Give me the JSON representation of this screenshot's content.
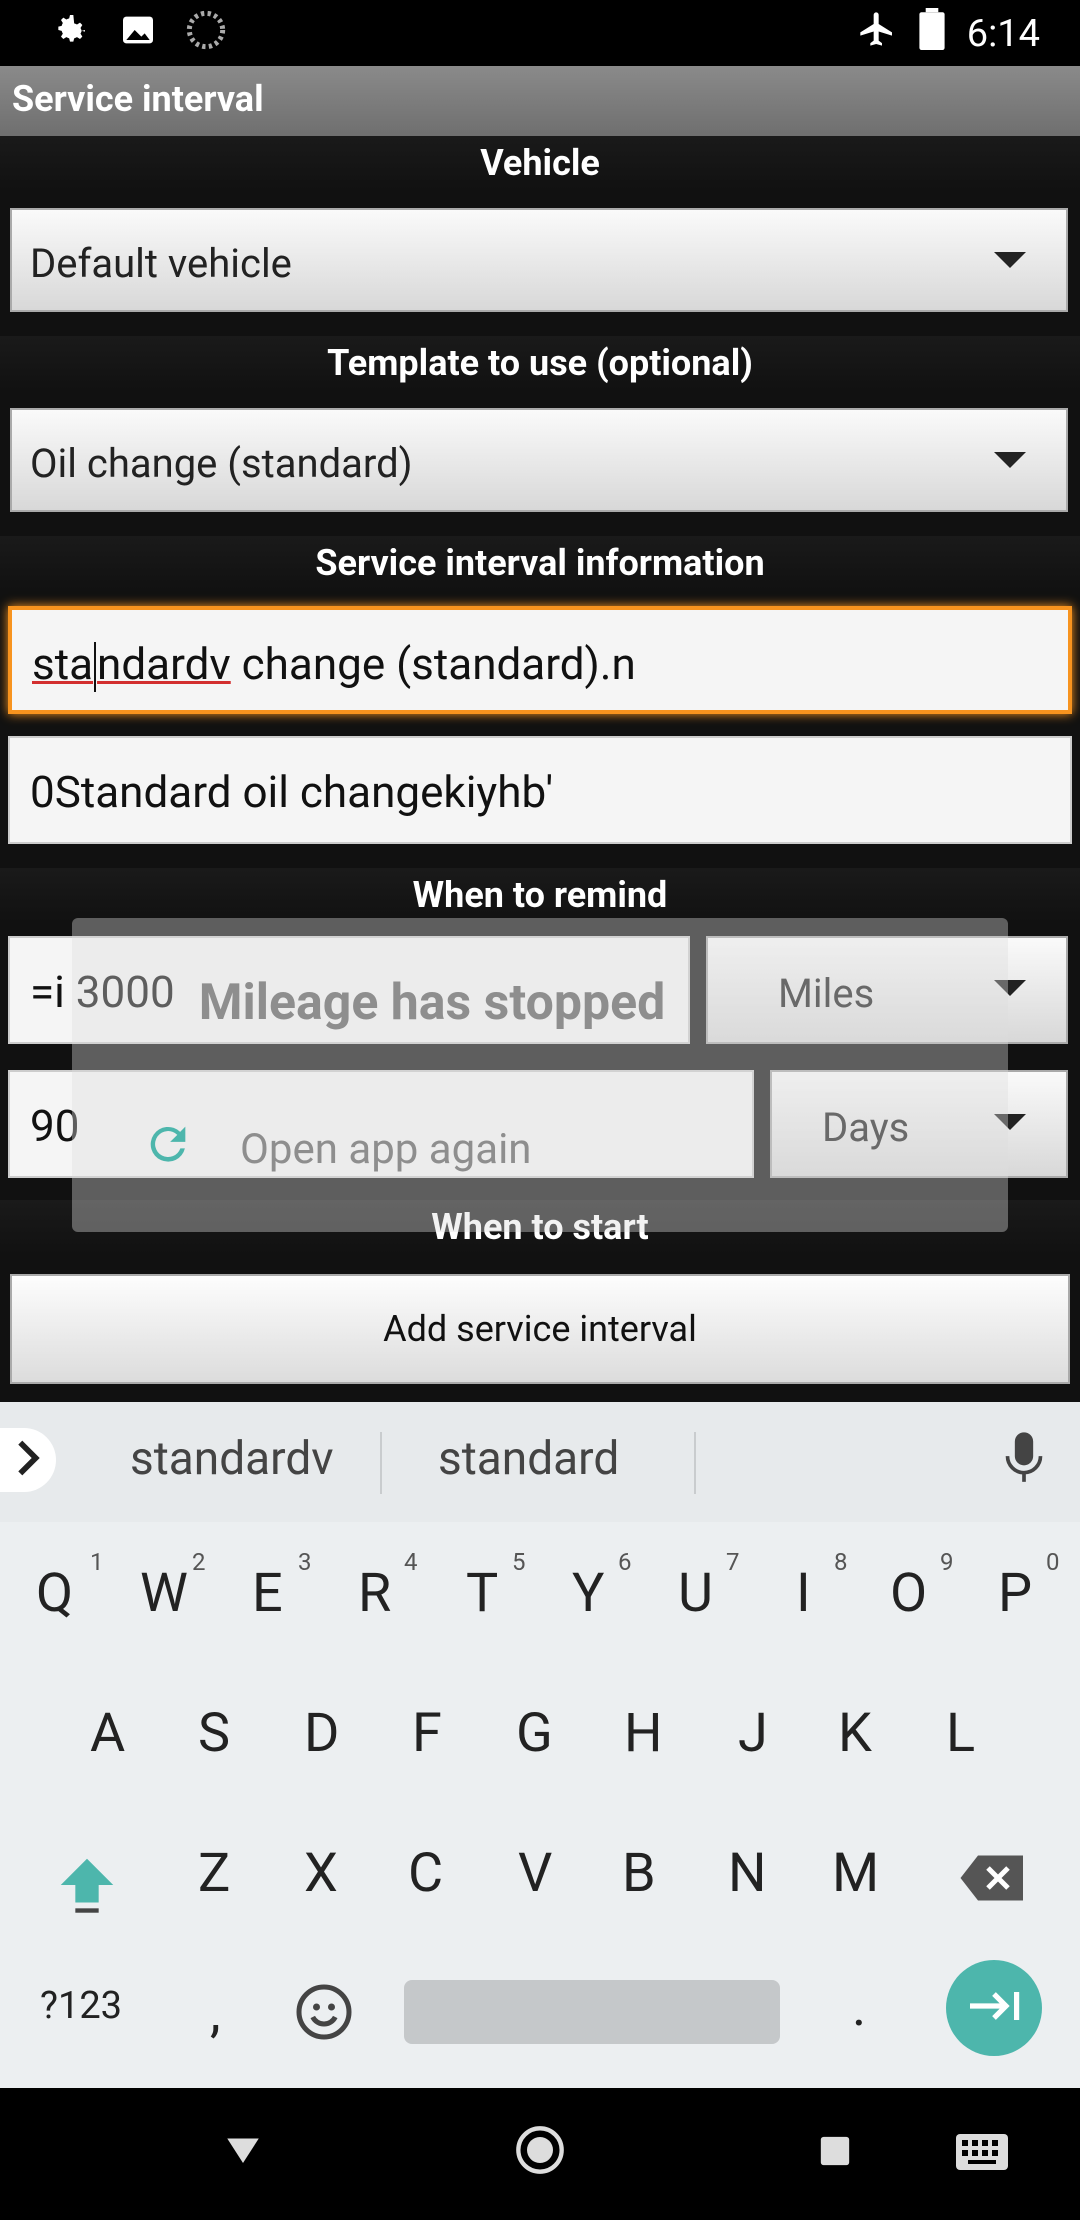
{
  "status_bar": {
    "time": "6:14"
  },
  "app": {
    "title": "Service interval"
  },
  "form": {
    "vehicle_header": "Vehicle",
    "vehicle_value": "Default vehicle",
    "template_header": "Template to use (optional)",
    "template_value": "Oil change (standard)",
    "info_header": "Service interval information",
    "name_prefix": "sta",
    "name_underlined_rest": "ndardv",
    "name_suffix": " change (standard).n",
    "description_value": "0Standard oil changekiyhb'",
    "remind_header": "When to remind",
    "mileage_value": "=i 3000",
    "mileage_unit": "Miles",
    "days_value": "90",
    "days_unit": "Days",
    "start_header": "When to start",
    "add_button": "Add service interval"
  },
  "overlay": {
    "title": "Mileage has stopped",
    "action": "Open app again",
    "accent": "#4db6ac"
  },
  "keyboard": {
    "suggestions": [
      "standardv",
      "standard"
    ],
    "row1": [
      "Q",
      "W",
      "E",
      "R",
      "T",
      "Y",
      "U",
      "I",
      "O",
      "P"
    ],
    "row1_hints": [
      "1",
      "2",
      "3",
      "4",
      "5",
      "6",
      "7",
      "8",
      "9",
      "0"
    ],
    "row2": [
      "A",
      "S",
      "D",
      "F",
      "G",
      "H",
      "J",
      "K",
      "L"
    ],
    "row3": [
      "Z",
      "X",
      "C",
      "V",
      "B",
      "N",
      "M"
    ],
    "symbols_label": "?123",
    "comma": ",",
    "period": ".",
    "accent": "#4db6ac"
  }
}
